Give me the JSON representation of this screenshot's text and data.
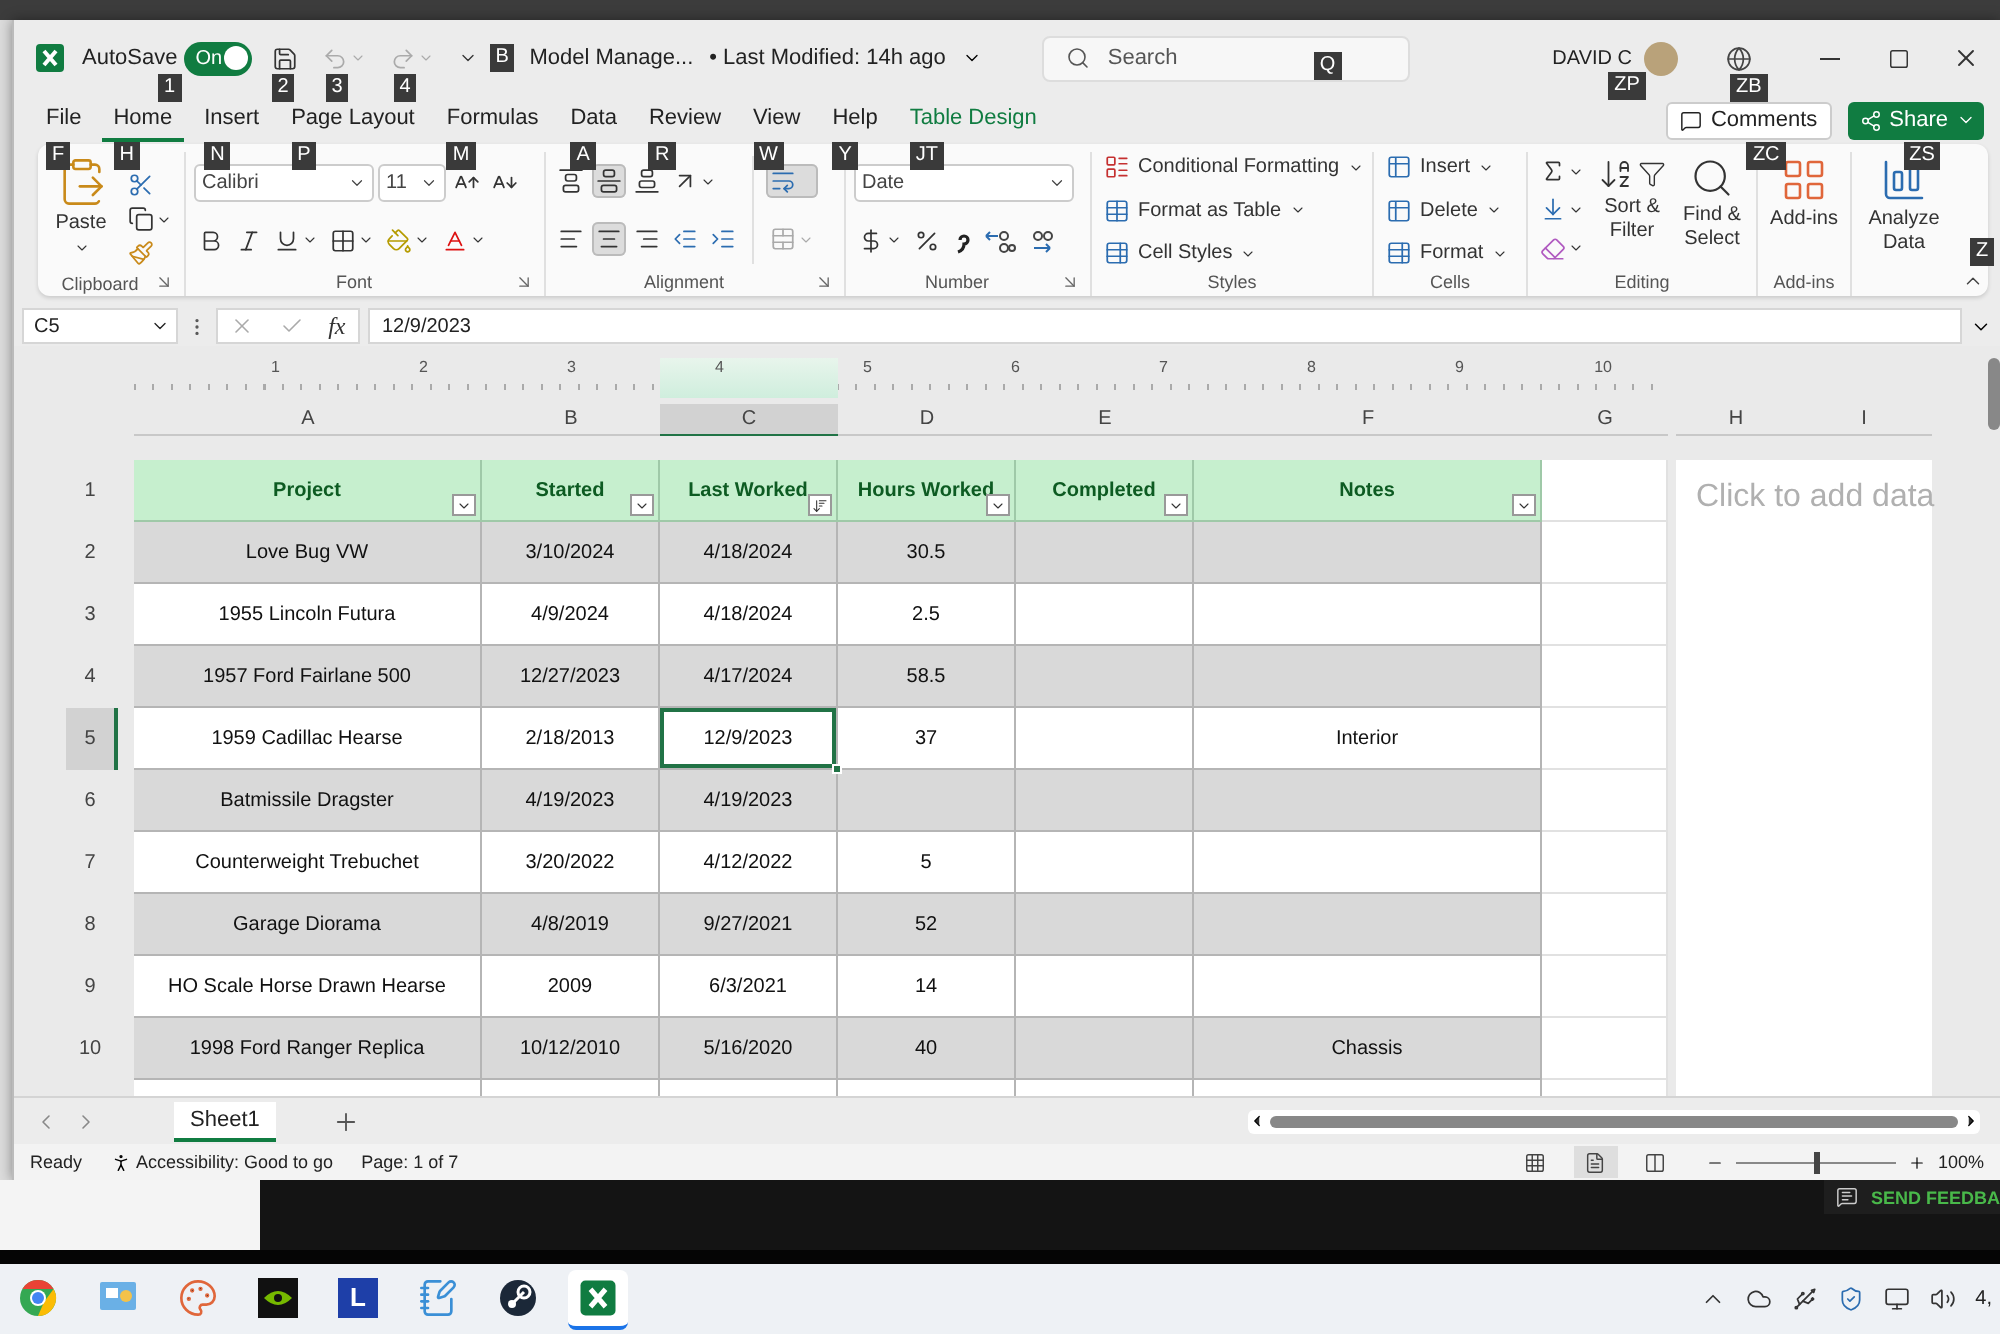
{
  "title_bar": {
    "quick_access": [
      {
        "kind": "autosave",
        "label": "AutoSave",
        "state": "On",
        "on": true,
        "keytip": "1"
      },
      {
        "kind": "save",
        "keytip": "2",
        "disabled": false
      },
      {
        "kind": "undo",
        "keytip": "3",
        "disabled": true
      },
      {
        "kind": "redo",
        "keytip": "4",
        "disabled": true
      },
      {
        "kind": "customize",
        "keytip": "B"
      }
    ],
    "file_name": "Model Manage...",
    "modified": "• Last Modified: 14h ago",
    "search": {
      "placeholder": "Search",
      "keytip": "Q"
    },
    "user": {
      "name": "DAVID C",
      "keytip": "ZP"
    },
    "coauthoring_keytip": "ZB"
  },
  "tabs": [
    {
      "label": "File",
      "keytip": "F",
      "selected": false,
      "contextual": false
    },
    {
      "label": "Home",
      "keytip": "H",
      "selected": true,
      "contextual": false
    },
    {
      "label": "Insert",
      "keytip": "N",
      "selected": false,
      "contextual": false
    },
    {
      "label": "Page Layout",
      "keytip": "P",
      "selected": false,
      "contextual": false
    },
    {
      "label": "Formulas",
      "keytip": "M",
      "selected": false,
      "contextual": false
    },
    {
      "label": "Data",
      "keytip": "A",
      "selected": false,
      "contextual": false
    },
    {
      "label": "Review",
      "keytip": "R",
      "selected": false,
      "contextual": false
    },
    {
      "label": "View",
      "keytip": "W",
      "selected": false,
      "contextual": false
    },
    {
      "label": "Help",
      "keytip": "Y",
      "selected": false,
      "contextual": false
    },
    {
      "label": "Table Design",
      "keytip": "JT",
      "selected": false,
      "contextual": true
    }
  ],
  "comments": {
    "label": "Comments",
    "keytip": "ZC"
  },
  "share": {
    "label": "Share",
    "keytip": "ZS"
  },
  "ribbon": {
    "collapse_keytip": "Z",
    "groups": [
      {
        "kind": "clipboard",
        "label": "Clipboard",
        "launcher": true,
        "paste": "Paste"
      },
      {
        "kind": "font",
        "label": "Font",
        "launcher": true,
        "font_name": "Calibri",
        "font_size": "11"
      },
      {
        "kind": "alignment",
        "label": "Alignment",
        "launcher": true,
        "vertical": [
          {
            "kind": "top",
            "selected": false
          },
          {
            "kind": "middle",
            "selected": true
          },
          {
            "kind": "bottom",
            "selected": false
          }
        ],
        "horizontal": [
          {
            "kind": "left",
            "selected": false
          },
          {
            "kind": "center",
            "selected": true
          },
          {
            "kind": "right",
            "selected": false
          }
        ],
        "wrap_text": true
      },
      {
        "kind": "number",
        "label": "Number",
        "launcher": true,
        "format": "Date"
      },
      {
        "kind": "styles",
        "label": "Styles",
        "launcher": false,
        "items": [
          "Conditional Formatting",
          "Format as Table",
          "Cell Styles"
        ]
      },
      {
        "kind": "cells",
        "label": "Cells",
        "launcher": false,
        "items": [
          "Insert",
          "Delete",
          "Format"
        ]
      },
      {
        "kind": "editing",
        "label": "Editing",
        "launcher": false,
        "items": [
          "Sort & Filter",
          "Find & Select"
        ]
      },
      {
        "kind": "addins",
        "label": "Add-ins",
        "launcher": false,
        "items": [
          "Add-ins"
        ]
      },
      {
        "kind": "analyze",
        "launcher": false,
        "items": [
          "Analyze Data"
        ]
      }
    ]
  },
  "formula_bar": {
    "name_box": "C5",
    "function_label": "fx",
    "value": "12/9/2023"
  },
  "sheet": {
    "ruler": [
      "1",
      "2",
      "3",
      "4",
      "5",
      "6",
      "7",
      "8",
      "9",
      "10"
    ],
    "columns": [
      {
        "letter": "A",
        "selected": false
      },
      {
        "letter": "B",
        "selected": false
      },
      {
        "letter": "C",
        "selected": true
      },
      {
        "letter": "D",
        "selected": false
      },
      {
        "letter": "E",
        "selected": false
      },
      {
        "letter": "F",
        "selected": false
      },
      {
        "letter": "G",
        "selected": false
      },
      {
        "letter": "H",
        "selected": false
      },
      {
        "letter": "I",
        "selected": false
      }
    ],
    "row_headers": [
      {
        "label": "1",
        "selected": false
      },
      {
        "label": "2",
        "selected": false
      },
      {
        "label": "3",
        "selected": false
      },
      {
        "label": "4",
        "selected": false
      },
      {
        "label": "5",
        "selected": true
      },
      {
        "label": "6",
        "selected": false
      },
      {
        "label": "7",
        "selected": false
      },
      {
        "label": "8",
        "selected": false
      },
      {
        "label": "9",
        "selected": false
      },
      {
        "label": "10",
        "selected": false
      }
    ],
    "table": {
      "columns": [
        {
          "label": "Project",
          "sorted": false
        },
        {
          "label": "Started",
          "sorted": false
        },
        {
          "label": "Last Worked",
          "sorted": true
        },
        {
          "label": "Hours Worked",
          "sorted": false
        },
        {
          "label": "Completed",
          "sorted": false
        },
        {
          "label": "Notes",
          "sorted": false
        }
      ],
      "rows": [
        [
          "Love Bug VW",
          "3/10/2024",
          "4/18/2024",
          "30.5",
          null,
          null
        ],
        [
          "1955 Lincoln Futura",
          "4/9/2024",
          "4/18/2024",
          "2.5",
          null,
          null
        ],
        [
          "1957 Ford Fairlane 500",
          "12/27/2023",
          "4/17/2024",
          "58.5",
          null,
          null
        ],
        [
          "1959 Cadillac Hearse",
          "2/18/2013",
          "12/9/2023",
          "37",
          null,
          "Interior"
        ],
        [
          "Batmissile Dragster",
          "4/19/2023",
          "4/19/2023",
          null,
          null,
          null
        ],
        [
          "Counterweight Trebuchet",
          "3/20/2022",
          "4/12/2022",
          "5",
          null,
          null
        ],
        [
          "Garage Diorama",
          "4/8/2019",
          "9/27/2021",
          "52",
          null,
          null
        ],
        [
          "HO Scale Horse Drawn Hearse",
          "2009",
          "6/3/2021",
          "14",
          null,
          null
        ],
        [
          "1998 Ford Ranger Replica",
          "10/12/2010",
          "5/16/2020",
          "40",
          null,
          "Chassis"
        ]
      ]
    },
    "page_placeholder": "Click to add data"
  },
  "sheet_tabs": [
    {
      "label": "Sheet1",
      "selected": true
    }
  ],
  "status_bar": {
    "ready": "Ready",
    "accessibility": "Accessibility: Good to go",
    "page": "Page: 1 of 7",
    "views": [
      {
        "kind": "normal",
        "selected": false
      },
      {
        "kind": "page-layout",
        "selected": true
      },
      {
        "kind": "page-break",
        "selected": false
      }
    ],
    "zoom": {
      "level": 0.5,
      "reading": "100%"
    }
  },
  "feedback": "SEND FEEDBA",
  "taskbar": {
    "apps": [
      {
        "kind": "chrome",
        "active": false
      },
      {
        "kind": "control-panel",
        "active": false
      },
      {
        "kind": "paint",
        "active": false
      },
      {
        "kind": "nvidia",
        "active": false
      },
      {
        "kind": "letter-tile",
        "label": "L",
        "active": false
      },
      {
        "kind": "notepad",
        "active": false
      },
      {
        "kind": "steam",
        "active": false
      },
      {
        "kind": "excel",
        "active": true
      }
    ],
    "clock": "4,"
  }
}
